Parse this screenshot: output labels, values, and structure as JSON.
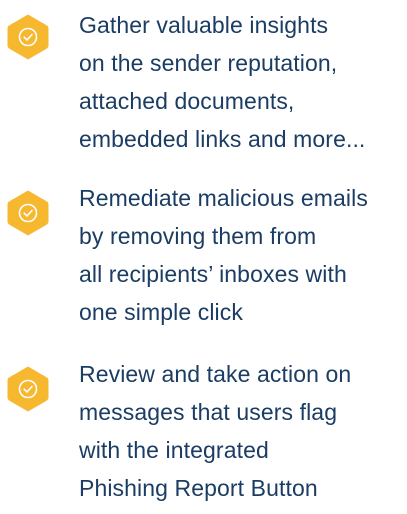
{
  "colors": {
    "accent": "#f5b82e",
    "text": "#1b3c63",
    "icon_stroke": "#ffffff"
  },
  "features": [
    {
      "icon": "check-circle-icon",
      "lines": [
        "Gather valuable insights",
        "on the sender reputation,",
        "attached documents,",
        "embedded links and more..."
      ]
    },
    {
      "icon": "check-circle-icon",
      "lines": [
        "Remediate malicious emails",
        "by removing them from",
        "all recipients’ inboxes with",
        "one simple click"
      ]
    },
    {
      "icon": "check-circle-icon",
      "lines": [
        "Review and take action on",
        "messages that users flag",
        "with the integrated",
        "Phishing Report Button"
      ]
    }
  ]
}
